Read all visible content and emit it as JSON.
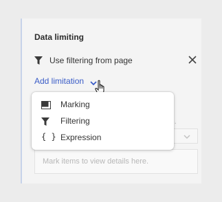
{
  "panel": {
    "title": "Data limiting",
    "filter_label": "Use filtering from page",
    "add_limitation_label": "Add limitation"
  },
  "background": {
    "truncated_text": "ual...",
    "details_placeholder": "Mark items to view details here."
  },
  "menu": {
    "items": [
      {
        "label": "Marking",
        "icon": "marking-icon"
      },
      {
        "label": "Filtering",
        "icon": "filter-icon"
      },
      {
        "label": "Expression",
        "icon": "braces-icon"
      }
    ]
  },
  "colors": {
    "accent": "#3a5cc7",
    "panel_border": "#c7d3ea"
  }
}
